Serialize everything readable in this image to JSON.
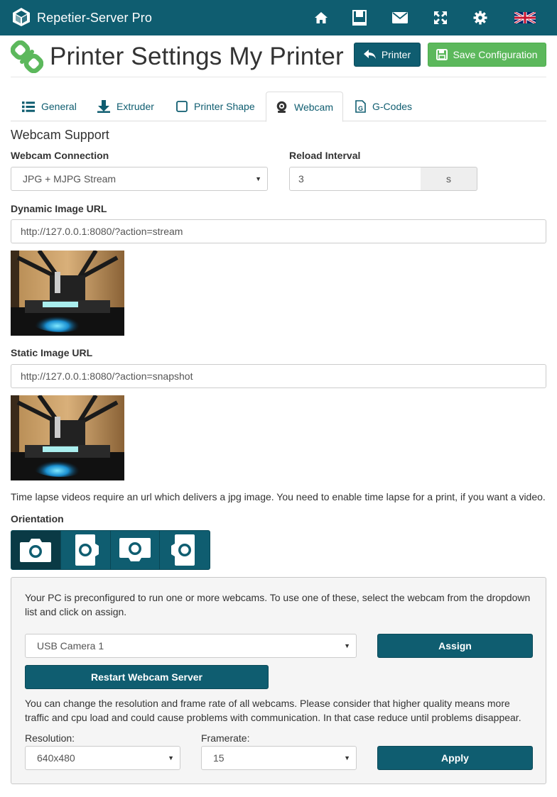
{
  "app": {
    "title": "Repetier-Server Pro",
    "accent": "#0f5d70",
    "success": "#5cb85c"
  },
  "nav": {
    "icons": [
      "home-icon",
      "book-icon",
      "envelope-icon",
      "fullscreen-icon",
      "gear-icon",
      "uk-flag-icon"
    ]
  },
  "header": {
    "title": "Printer Settings My Printer",
    "printer_button": "Printer",
    "save_button": "Save Configuration"
  },
  "tabs": [
    {
      "label": "General",
      "icon": "list-icon"
    },
    {
      "label": "Extruder",
      "icon": "download-arrow-icon"
    },
    {
      "label": "Printer Shape",
      "icon": "square-icon"
    },
    {
      "label": "Webcam",
      "icon": "webcam-icon",
      "active": true
    },
    {
      "label": "G-Codes",
      "icon": "gcode-file-icon"
    }
  ],
  "webcam": {
    "section_title": "Webcam Support",
    "connection_label": "Webcam Connection",
    "connection_value": "JPG + MJPG Stream",
    "reload_label": "Reload Interval",
    "reload_value": "3",
    "reload_unit": "s",
    "dynamic_label": "Dynamic Image URL",
    "dynamic_url": "http://127.0.0.1:8080/?action=stream",
    "static_label": "Static Image URL",
    "static_url": "http://127.0.0.1:8080/?action=snapshot",
    "timelapse_text": "Time lapse videos require an url which delivers a jpg image. You need to enable time lapse for a print, if you want a video.",
    "orientation_label": "Orientation"
  },
  "well": {
    "preconfig_text": "Your PC is preconfigured to run one or more webcams. To use one of these, select the webcam from the dropdown list and click on assign.",
    "camera_value": "USB Camera 1",
    "assign_button": "Assign",
    "restart_button": "Restart Webcam Server",
    "change_text": "You can change the resolution and frame rate of all webcams. Please consider that higher quality means more traffic and cpu load and could cause problems with communication. In that case reduce until problems disappear.",
    "resolution_label": "Resolution:",
    "resolution_value": "640x480",
    "framerate_label": "Framerate:",
    "framerate_value": "15",
    "apply_button": "Apply"
  }
}
